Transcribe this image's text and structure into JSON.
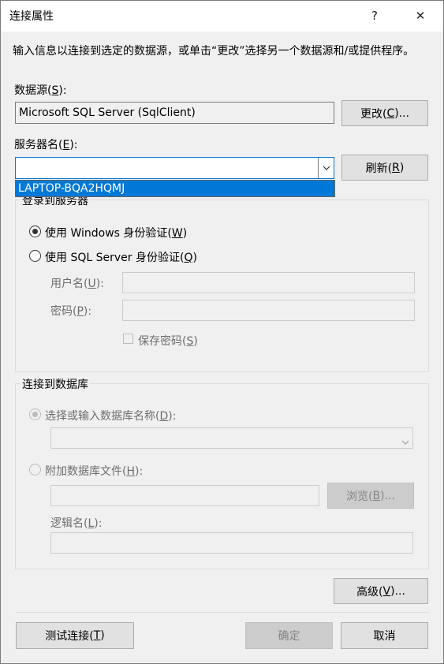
{
  "window": {
    "title": "连接属性",
    "help_label": "?",
    "close_label": "✕"
  },
  "description": "输入信息以连接到选定的数据源，或单击“更改”选择另一个数据源和/或提供程序。",
  "datasource": {
    "label_pre": "数据源(",
    "label_key": "S",
    "label_post": "):",
    "value": "Microsoft SQL Server (SqlClient)",
    "change_pre": "更改(",
    "change_key": "C",
    "change_post": ")..."
  },
  "server": {
    "label_pre": "服务器名(",
    "label_key": "E",
    "label_post": "):",
    "value": "",
    "refresh_pre": "刷新(",
    "refresh_key": "R",
    "refresh_post": ")",
    "dropdown_option": "LAPTOP-BQA2HQMJ"
  },
  "login": {
    "group_title": "登录到服务器",
    "windows_auth_pre": "使用 Windows 身份验证(",
    "windows_auth_key": "W",
    "windows_auth_post": ")",
    "sql_auth_pre": "使用 SQL Server 身份验证(",
    "sql_auth_key": "Q",
    "sql_auth_post": ")",
    "username_pre": "用户名(",
    "username_key": "U",
    "username_post": "):",
    "password_pre": "密码(",
    "password_key": "P",
    "password_post": "):",
    "save_pwd_pre": "保存密码(",
    "save_pwd_key": "S",
    "save_pwd_post": ")",
    "selected": "windows"
  },
  "database": {
    "group_title": "连接到数据库",
    "select_db_pre": "选择或输入数据库名称(",
    "select_db_key": "D",
    "select_db_post": "):",
    "attach_pre": "附加数据库文件(",
    "attach_key": "H",
    "attach_post": "):",
    "browse_pre": "浏览(",
    "browse_key": "B",
    "browse_post": ")...",
    "logical_pre": "逻辑名(",
    "logical_key": "L",
    "logical_post": "):"
  },
  "advanced_pre": "高级(",
  "advanced_key": "V",
  "advanced_post": ")...",
  "footer": {
    "test_pre": "测试连接(",
    "test_key": "T",
    "test_post": ")",
    "ok_label": "确定",
    "cancel_label": "取消"
  },
  "colors": {
    "accent": "#0078d7",
    "background": "#f0f0f0"
  }
}
